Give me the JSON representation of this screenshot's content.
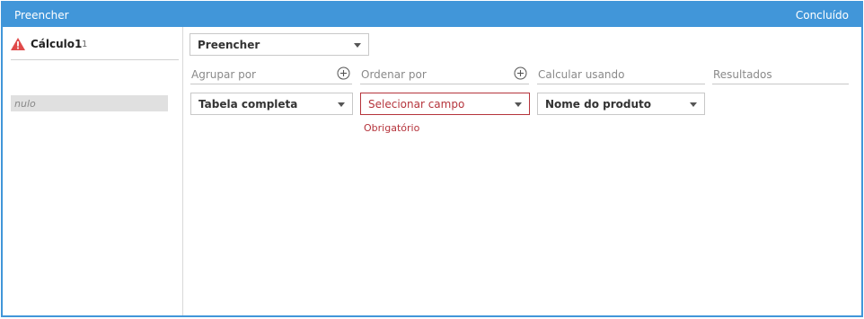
{
  "titlebar": {
    "title": "Preencher",
    "done_label": "Concluído"
  },
  "left_panel": {
    "calc_name": "Cálculo1",
    "calc_count": "1",
    "null_value": "nulo"
  },
  "main": {
    "function_select": {
      "value": "Preencher"
    },
    "group_by": {
      "header": "Agrupar por",
      "value": "Tabela completa"
    },
    "order_by": {
      "header": "Ordenar por",
      "value": "Selecionar campo",
      "required_text": "Obrigatório"
    },
    "calculate_using": {
      "header": "Calcular usando",
      "value": "Nome do produto"
    },
    "results": {
      "header": "Resultados"
    }
  },
  "colors": {
    "accent": "#4196d9",
    "error": "#b5343c",
    "warning": "#e04a4a"
  },
  "icons": {
    "warning": "warning-triangle-icon",
    "add": "plus-circle-icon",
    "dropdown": "chevron-down-icon"
  }
}
